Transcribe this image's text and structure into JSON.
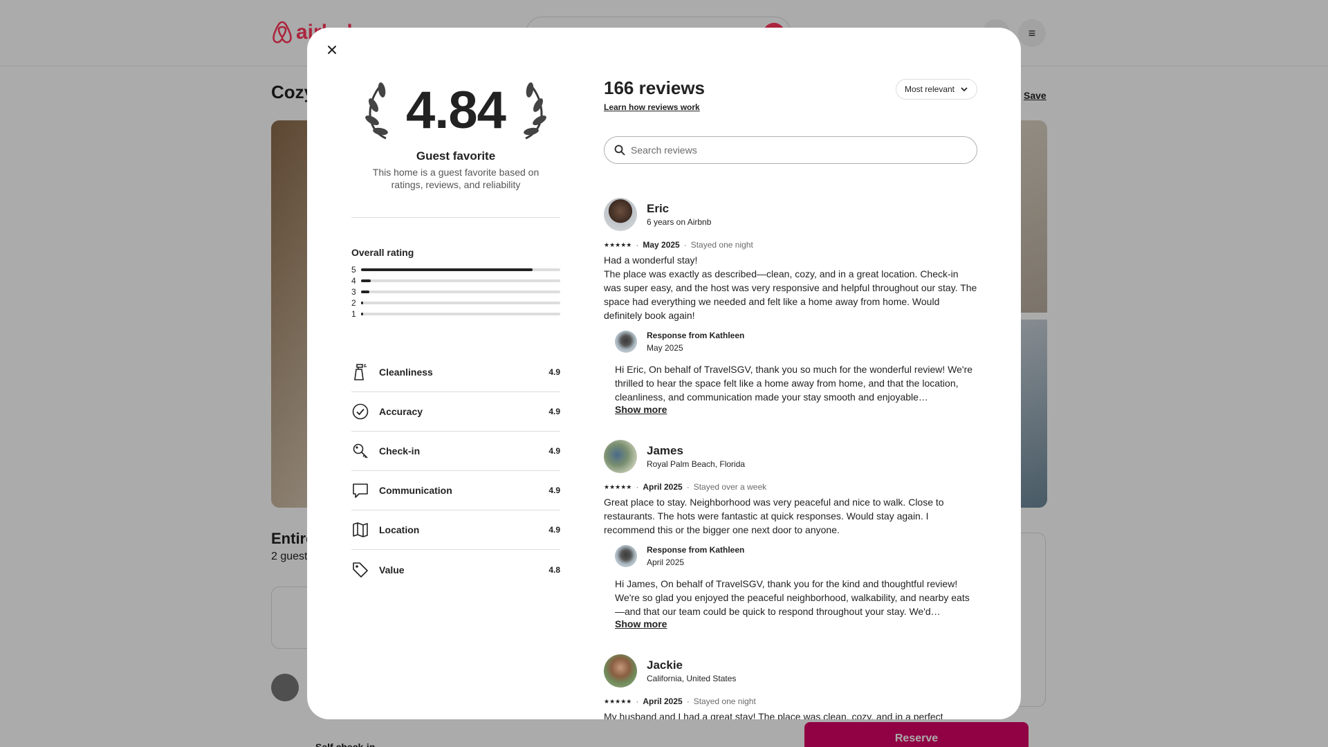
{
  "background": {
    "logo_text": "airbnb",
    "listing_title": "Cozy",
    "save_label": "Save",
    "subtitle": "Entire",
    "subline": "2 guest",
    "self_checkin": "Self check-in",
    "reserve_label": "Reserve"
  },
  "modal": {
    "rating": "4.84",
    "guest_favorite_title": "Guest favorite",
    "guest_favorite_desc": "This home is a guest favorite based on ratings, reviews, and reliability",
    "overall_label": "Overall rating",
    "distribution": [
      {
        "stars": "5",
        "fraction": 0.86
      },
      {
        "stars": "4",
        "fraction": 0.05
      },
      {
        "stars": "3",
        "fraction": 0.04
      },
      {
        "stars": "2",
        "fraction": 0.0
      },
      {
        "stars": "1",
        "fraction": 0.01
      }
    ],
    "categories": [
      {
        "label": "Cleanliness",
        "score": "4.9",
        "icon": "spray-bottle-icon"
      },
      {
        "label": "Accuracy",
        "score": "4.9",
        "icon": "check-circle-icon"
      },
      {
        "label": "Check-in",
        "score": "4.9",
        "icon": "key-icon"
      },
      {
        "label": "Communication",
        "score": "4.9",
        "icon": "chat-bubble-icon"
      },
      {
        "label": "Location",
        "score": "4.9",
        "icon": "map-icon"
      },
      {
        "label": "Value",
        "score": "4.8",
        "icon": "tag-icon"
      }
    ],
    "reviews_count": "166 reviews",
    "learn_link": "Learn how reviews work",
    "sort_label": "Most relevant",
    "search_placeholder": "Search reviews",
    "show_more": "Show more",
    "reviews": [
      {
        "name": "Eric",
        "sub": "6 years on Airbnb",
        "date": "May 2025",
        "stay": "Stayed one night",
        "text": "Had a wonderful stay!\nThe place was exactly as described—clean, cozy, and in a great location. Check-in was super easy, and the host was very responsive and helpful throughout our stay. The space had everything we needed and felt like a home away from home. Would definitely book again!",
        "response_from": "Response from Kathleen",
        "response_date": "May 2025",
        "response_text": "Hi Eric, On behalf of TravelSGV, thank you so much for the wonderful review! We're thrilled to hear the space felt like a home away from home, and that the location, cleanliness, and communication made your stay smooth and enjoyable…"
      },
      {
        "name": "James",
        "sub": "Royal Palm Beach, Florida",
        "date": "April 2025",
        "stay": "Stayed over a week",
        "text": "Great place to stay. Neighborhood was very peaceful and nice to walk. Close to restaurants. The hots were fantastic at quick responses. Would stay again. I recommend this or the bigger one next door to anyone.",
        "response_from": "Response from Kathleen",
        "response_date": "April 2025",
        "response_text": "Hi James, On behalf of TravelSGV, thank you for the kind and thoughtful review! We're so glad you enjoyed the peaceful neighborhood, walkability, and nearby eats—and that our team could be quick to respond throughout your stay. We'd…"
      },
      {
        "name": "Jackie",
        "sub": "California, United States",
        "date": "April 2025",
        "stay": "Stayed one night",
        "text": "My husband and I had a great stay! The place was clean, cozy, and in a perfect"
      }
    ],
    "stars_glyph": "★★★★★",
    "separator": "·"
  }
}
